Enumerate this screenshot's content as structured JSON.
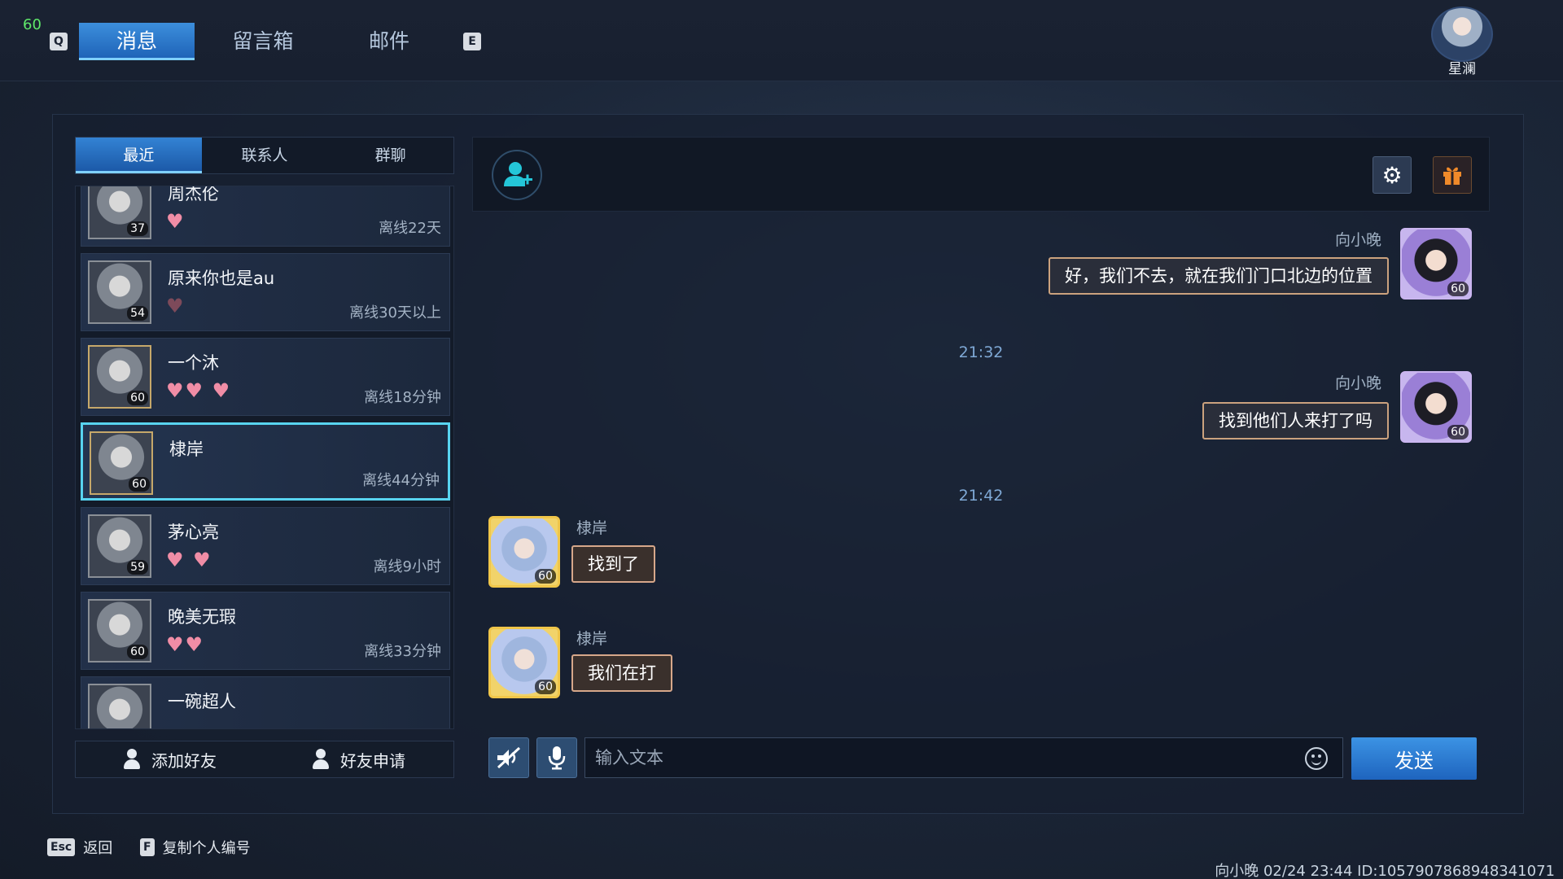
{
  "topbar": {
    "fps": "60",
    "key_left": "Q",
    "key_right": "E",
    "tabs": [
      {
        "label": "消息",
        "active": true
      },
      {
        "label": "留言箱",
        "active": false
      },
      {
        "label": "邮件",
        "active": false
      }
    ],
    "user_name": "星澜"
  },
  "sidebar": {
    "subtabs": [
      {
        "label": "最近",
        "active": true
      },
      {
        "label": "联系人",
        "active": false
      },
      {
        "label": "群聊",
        "active": false
      }
    ],
    "contacts": [
      {
        "name": "周杰伦",
        "level": "37",
        "status": "离线22天",
        "hearts": "♥"
      },
      {
        "name": "原来你也是au",
        "level": "54",
        "status": "离线30天以上",
        "hearts": "♥"
      },
      {
        "name": "一个沐",
        "level": "60",
        "status": "离线18分钟",
        "hearts": "♥♥ ♥"
      },
      {
        "name": "棣岸",
        "level": "60",
        "status": "离线44分钟",
        "hearts": "",
        "selected": true
      },
      {
        "name": "茅心亮",
        "level": "59",
        "status": "离线9小时",
        "hearts": "♥ ♥"
      },
      {
        "name": "晚美无瑕",
        "level": "60",
        "status": "离线33分钟",
        "hearts": "♥♥"
      },
      {
        "name": "一碗超人",
        "level": "",
        "status": "",
        "hearts": ""
      }
    ],
    "add_friend_label": "添加好友",
    "friend_request_label": "好友申请"
  },
  "chat": {
    "messages": [
      {
        "type": "out",
        "sender": "向小晚",
        "text": "好，我们不去，就在我们门口北边的位置",
        "level": "60"
      },
      {
        "type": "time",
        "text": "21:32"
      },
      {
        "type": "out",
        "sender": "向小晚",
        "text": "找到他们人来打了吗",
        "level": "60"
      },
      {
        "type": "time",
        "text": "21:42"
      },
      {
        "type": "in",
        "sender": "棣岸",
        "text": "找到了",
        "level": "60"
      },
      {
        "type": "in",
        "sender": "棣岸",
        "text": "我们在打",
        "level": "60"
      }
    ],
    "input_placeholder": "输入文本",
    "send_label": "发送"
  },
  "footer": {
    "esc_key": "Esc",
    "esc_label": "返回",
    "f_key": "F",
    "f_label": "复制个人编号",
    "info": "向小晚  02/24 23:44  ID:1057907868948341071"
  },
  "colors": {
    "accent": "#2b7fd6",
    "selected_border": "#58d4f0",
    "fps": "#5fe86a"
  }
}
